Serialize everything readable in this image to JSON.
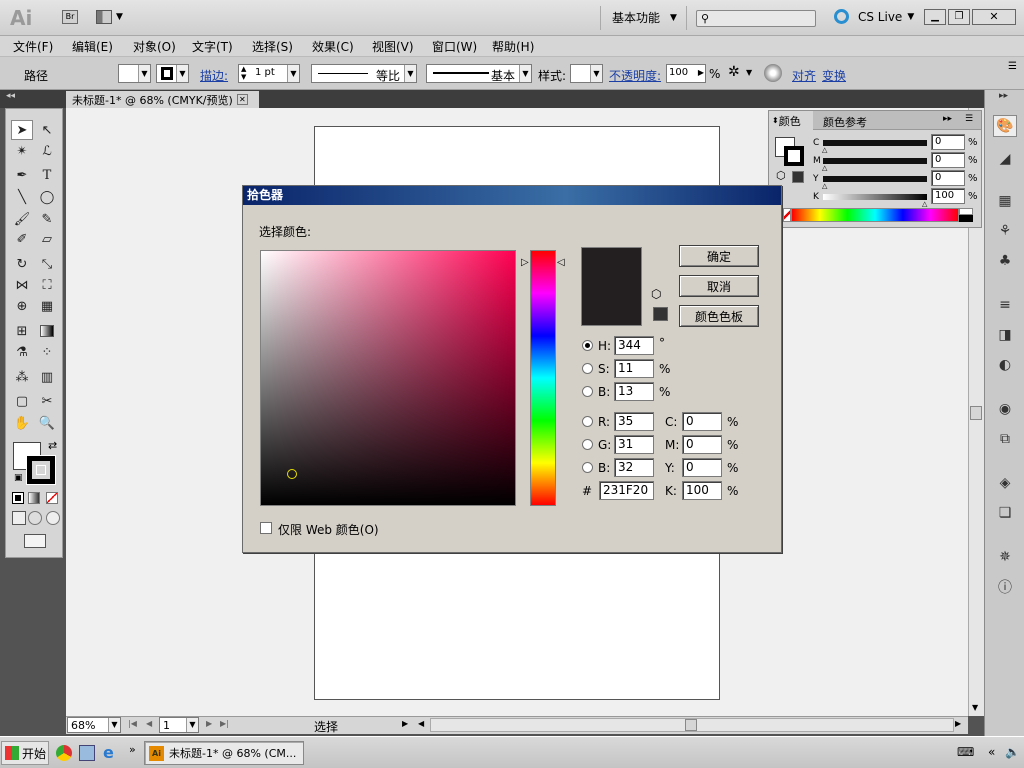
{
  "app": {
    "logo": "Ai",
    "bridge_label": "Br",
    "workspace_label": "基本功能",
    "cs_live_label": "CS Live",
    "search_placeholder": ""
  },
  "menu": [
    "文件(F)",
    "编辑(E)",
    "对象(O)",
    "文字(T)",
    "选择(S)",
    "效果(C)",
    "视图(V)",
    "窗口(W)",
    "帮助(H)"
  ],
  "control_bar": {
    "selection_label": "路径",
    "stroke_link": "描边:",
    "stroke_weight": "1 pt",
    "profile_label": "等比",
    "brush_label": "基本",
    "style_label": "样式:",
    "opacity_link": "不透明度:",
    "opacity_value": "100",
    "opacity_unit": "%",
    "align_link": "对齐",
    "transform_link": "变换"
  },
  "document_tab": "未标题-1* @ 68% (CMYK/预览)",
  "color_panel": {
    "tab_color": "颜色",
    "tab_guide": "颜色参考",
    "channels": [
      {
        "label": "C",
        "value": "0",
        "unit": "%"
      },
      {
        "label": "M",
        "value": "0",
        "unit": "%"
      },
      {
        "label": "Y",
        "value": "0",
        "unit": "%"
      },
      {
        "label": "K",
        "value": "100",
        "unit": "%"
      }
    ]
  },
  "dialog": {
    "title": "拾色器",
    "select_label": "选择颜色:",
    "ok_button": "确定",
    "cancel_button": "取消",
    "swatches_button": "颜色色板",
    "current_color": "#231F20",
    "hue_color": "#ff0052",
    "hsb": [
      {
        "label": "H:",
        "value": "344",
        "unit": "°"
      },
      {
        "label": "S:",
        "value": "11",
        "unit": "%"
      },
      {
        "label": "B:",
        "value": "13",
        "unit": "%"
      }
    ],
    "rgb": [
      {
        "label": "R:",
        "value": "35"
      },
      {
        "label": "G:",
        "value": "31"
      },
      {
        "label": "B:",
        "value": "32"
      }
    ],
    "cmyk": [
      {
        "label": "C:",
        "value": "0",
        "unit": "%"
      },
      {
        "label": "M:",
        "value": "0",
        "unit": "%"
      },
      {
        "label": "Y:",
        "value": "0",
        "unit": "%"
      },
      {
        "label": "K:",
        "value": "100",
        "unit": "%"
      }
    ],
    "hex_label": "#",
    "hex_value": "231F20",
    "web_only_label": "仅限 Web 颜色(O)"
  },
  "status": {
    "zoom": "68%",
    "page": "1",
    "mode": "选择"
  },
  "taskbar": {
    "start_label": "开始",
    "task_label": "未标题-1* @ 68% (CM..."
  }
}
